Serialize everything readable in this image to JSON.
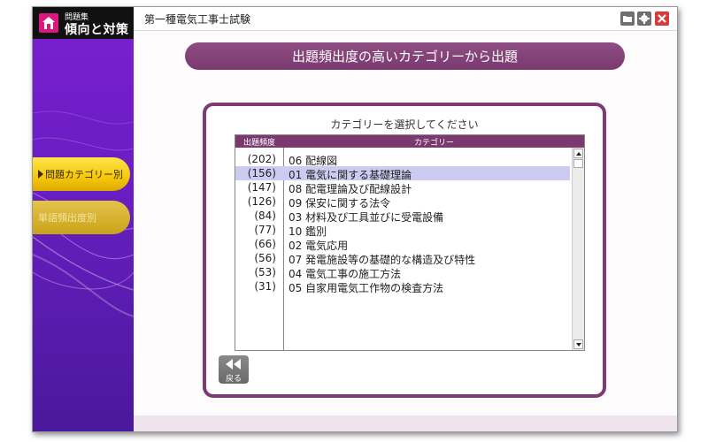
{
  "app": {
    "logo_sub": "問題集",
    "logo_main": "傾向と対策",
    "window_title": "第一種電気工事士試験"
  },
  "sidebar": {
    "items": [
      {
        "label": "問題カテゴリー別",
        "active": true
      },
      {
        "label": "単語頻出度別",
        "active": false
      }
    ]
  },
  "main": {
    "heading": "出題頻出度の高いカテゴリーから出題",
    "panel_title": "カテゴリーを選択してください",
    "columns": [
      "出題頻度",
      "カテゴリー"
    ],
    "rows": [
      {
        "freq": "(202)",
        "category": "06  配線図"
      },
      {
        "freq": "(156)",
        "category": "01  電気に関する基礎理論"
      },
      {
        "freq": "(147)",
        "category": "08  配電理論及び配線設計"
      },
      {
        "freq": "(126)",
        "category": "09  保安に関する法令"
      },
      {
        "freq": "(84)",
        "category": "03  材料及び工具並びに受電設備"
      },
      {
        "freq": "(77)",
        "category": "10  鑑別"
      },
      {
        "freq": "(66)",
        "category": "02  電気応用"
      },
      {
        "freq": "(56)",
        "category": "07  発電施設等の基礎的な構造及び特性"
      },
      {
        "freq": "(53)",
        "category": "04  電気工事の施工方法"
      },
      {
        "freq": "(31)",
        "category": "05  自家用電気工作物の検査方法"
      }
    ],
    "selected_index": 1,
    "back_label": "戻る"
  },
  "icons": {
    "logo": "house-icon",
    "folder": "folder-icon",
    "settings": "gear-icon",
    "close": "close-icon",
    "back": "rewind-icon"
  },
  "colors": {
    "accent": "#7a3a70",
    "sidebar": "#6a1ec2",
    "selected_row": "#ccccf2",
    "active_button": "#f5c80a"
  }
}
